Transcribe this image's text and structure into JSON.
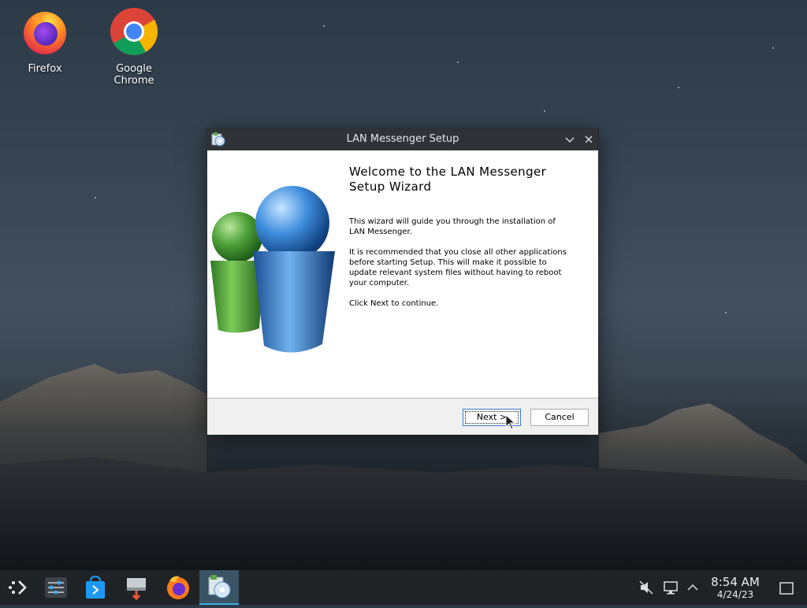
{
  "desktop": {
    "icons": [
      {
        "label": "Firefox"
      },
      {
        "label": "Google Chrome"
      }
    ]
  },
  "window": {
    "title": "LAN Messenger Setup",
    "heading": "Welcome to the LAN Messenger Setup Wizard",
    "paragraphs": [
      "This wizard will guide you through the installation of\nLAN Messenger.",
      "It is recommended that you close all other applications\nbefore starting Setup. This will make it possible to\nupdate relevant system files without having to reboot\nyour computer.",
      "Click Next to continue."
    ],
    "buttons": {
      "next": "Next >",
      "cancel": "Cancel"
    }
  },
  "taskbar": {
    "items": [
      "app-launcher-icon",
      "system-settings-icon",
      "discover-store-icon",
      "installer-tool-icon",
      "firefox-icon",
      "lan-messenger-setup-icon"
    ],
    "active_item": "lan-messenger-setup-icon",
    "tray": [
      "volume-muted-icon",
      "network-icon",
      "chevron-up-icon"
    ],
    "clock": {
      "time": "8:54 AM",
      "date": "4/24/23"
    }
  },
  "colors": {
    "accent": "#3daee9",
    "titlebar": "#2f3338",
    "taskbar": "#202326"
  }
}
